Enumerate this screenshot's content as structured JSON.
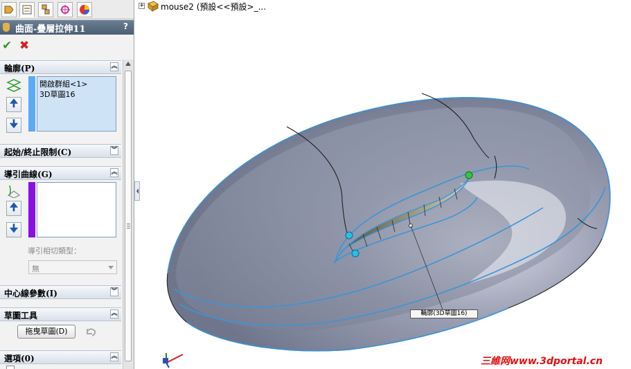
{
  "feature_tabs": [
    {
      "icon": "feature-manager-icon"
    },
    {
      "icon": "property-manager-icon"
    },
    {
      "icon": "configuration-manager-icon"
    },
    {
      "icon": "dimxpert-icon"
    },
    {
      "icon": "display-manager-icon"
    }
  ],
  "property_manager": {
    "title": "曲面-疊層拉伸11",
    "help": "?",
    "ok_glyph": "✔",
    "cancel_glyph": "✖"
  },
  "groups": {
    "profiles": {
      "title": "輪廓(P)",
      "items": [
        "開啟群組<1>",
        "3D草圖16"
      ],
      "color": "#5aaaf5",
      "up": "🠉",
      "down": "🠋"
    },
    "start_end": {
      "title": "起始/終止限制(C)"
    },
    "guides": {
      "title": "導引曲線(G)",
      "items": [],
      "color": "#8a10e6",
      "up": "🠉",
      "down": "🠋",
      "tangency_label": "導引相切類型：",
      "tangency_value": "無"
    },
    "centerline": {
      "title": "中心線參數(I)"
    },
    "sketch_tools": {
      "title": "草圖工具",
      "drag_button": "拖曳草圖(D)"
    },
    "options": {
      "title": "選項(0)"
    }
  },
  "graphics": {
    "tree_label": "mouse2 (預設<<預設>_...",
    "callout": "輪廓(3D草圖16)",
    "watermark": "三維网www.3dportal.cn",
    "colors": {
      "body": "#878ea3",
      "edges": "#3b94d9",
      "accent_red": "#e01010"
    }
  }
}
